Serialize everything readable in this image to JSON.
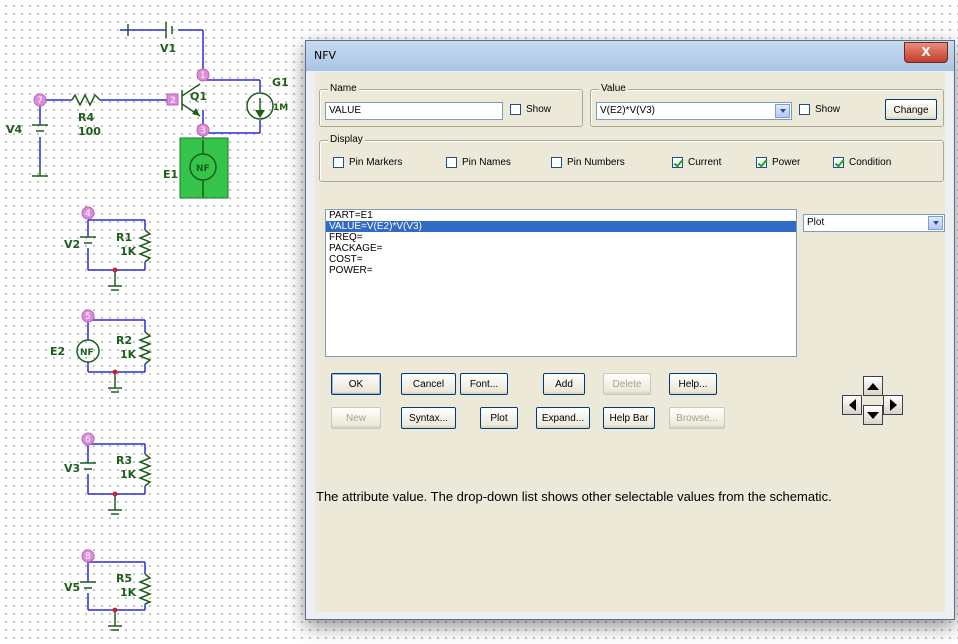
{
  "schematic": {
    "labels": {
      "V1": "V1",
      "Q1": "Q1",
      "G1": "G1",
      "G1_value": "1M",
      "R4": "R4",
      "R4_value": "100",
      "V4": "V4",
      "E1": "E1",
      "E1_symbol": "NF",
      "V2": "V2",
      "R1": "R1",
      "R1_value": "1K",
      "E2": "E2",
      "E2_symbol": "NF",
      "R2": "R2",
      "R2_value": "1K",
      "V3": "V3",
      "R3": "R3",
      "R3_value": "1K",
      "V5": "V5",
      "R5": "R5",
      "R5_value": "1K"
    },
    "nodes": {
      "n1": "1",
      "n2": "2",
      "n3": "3",
      "n4": "4",
      "n5": "5",
      "n6": "6",
      "n7": "7",
      "n8": "8"
    },
    "colors": {
      "wire": "#2b2bd6",
      "component": "#1d5e1d",
      "node": "#dc8ed8",
      "selection": "#35c44a",
      "ground_dot": "#cc2222"
    }
  },
  "dialog": {
    "title": "NFV",
    "close_label": "X",
    "name_group": {
      "label": "Name",
      "value": "VALUE",
      "show_label": "Show",
      "show_checked": false
    },
    "value_group": {
      "label": "Value",
      "value": "V(E2)*V(V3)",
      "show_label": "Show",
      "show_checked": false,
      "change_label": "Change"
    },
    "display_group": {
      "label": "Display",
      "options": [
        {
          "label": "Pin Markers",
          "checked": false
        },
        {
          "label": "Pin Names",
          "checked": false
        },
        {
          "label": "Pin Numbers",
          "checked": false
        },
        {
          "label": "Current",
          "checked": true
        },
        {
          "label": "Power",
          "checked": true
        },
        {
          "label": "Condition",
          "checked": true
        }
      ]
    },
    "attributes": [
      {
        "text": "PART=E1",
        "selected": false
      },
      {
        "text": "VALUE=V(E2)*V(V3)",
        "selected": true
      },
      {
        "text": "FREQ=",
        "selected": false
      },
      {
        "text": "PACKAGE=",
        "selected": false
      },
      {
        "text": "COST=",
        "selected": false
      },
      {
        "text": "POWER=",
        "selected": false
      }
    ],
    "plot_select": "Plot",
    "buttons_row1": [
      {
        "label": "OK",
        "enabled": true
      },
      {
        "label": "Cancel",
        "enabled": true
      },
      {
        "label": "Font...",
        "enabled": true
      },
      {
        "label": "Add",
        "enabled": true
      },
      {
        "label": "Delete",
        "enabled": false
      },
      {
        "label": "Help...",
        "enabled": true
      }
    ],
    "buttons_row2": [
      {
        "label": "New",
        "enabled": false
      },
      {
        "label": "Syntax...",
        "enabled": true
      },
      {
        "label": "Plot",
        "enabled": true
      },
      {
        "label": "Expand...",
        "enabled": true
      },
      {
        "label": "Help Bar",
        "enabled": true
      },
      {
        "label": "Browse...",
        "enabled": false
      }
    ],
    "help_text": "The attribute value. The drop-down list shows other selectable values from the schematic."
  }
}
